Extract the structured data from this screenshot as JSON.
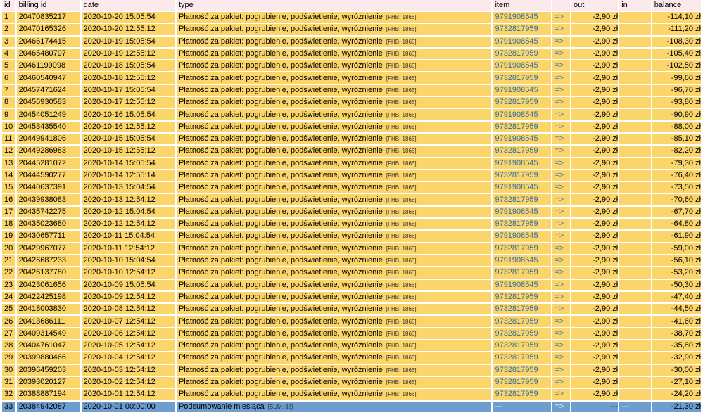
{
  "headers": {
    "id": "id",
    "billing_id": "billing id",
    "date": "date",
    "type": "type",
    "item": "item",
    "arrow": "",
    "out": "out",
    "in": "in",
    "balance": "balance"
  },
  "colors": {
    "row_bg": "#fbd56a",
    "summary_bg": "#6e9dcf",
    "header_bg": "#fce9ec",
    "link": "#2e6da8"
  },
  "rows": [
    {
      "id": "1",
      "billing_id": "20470835217",
      "date": "2020-10-20 15:05:54",
      "type": "Płatność za pakiet: pogrubienie, podświetlenie, wyróżnienie",
      "tag": "[FHB: 1866]",
      "item": "9791908545",
      "arrow": "=>",
      "out": "-2,90 zł",
      "in": "",
      "balance": "-114,10 zł"
    },
    {
      "id": "2",
      "billing_id": "20470165326",
      "date": "2020-10-20 12:55:12",
      "type": "Płatność za pakiet: pogrubienie, podświetlenie, wyróżnienie",
      "tag": "[FHB: 1866]",
      "item": "9732817959",
      "arrow": "=>",
      "out": "-2,90 zł",
      "in": "",
      "balance": "-111,20 zł"
    },
    {
      "id": "3",
      "billing_id": "20466174415",
      "date": "2020-10-19 15:05:54",
      "type": "Płatność za pakiet: pogrubienie, podświetlenie, wyróżnienie",
      "tag": "[FHB: 1866]",
      "item": "9791908545",
      "arrow": "=>",
      "out": "-2,90 zł",
      "in": "",
      "balance": "-108,30 zł"
    },
    {
      "id": "4",
      "billing_id": "20465480797",
      "date": "2020-10-19 12:55:12",
      "type": "Płatność za pakiet: pogrubienie, podświetlenie, wyróżnienie",
      "tag": "[FHB: 1866]",
      "item": "9732817959",
      "arrow": "=>",
      "out": "-2,90 zł",
      "in": "",
      "balance": "-105,40 zł"
    },
    {
      "id": "5",
      "billing_id": "20461199098",
      "date": "2020-10-18 15:05:54",
      "type": "Płatność za pakiet: pogrubienie, podświetlenie, wyróżnienie",
      "tag": "[FHB: 1866]",
      "item": "9791908545",
      "arrow": "=>",
      "out": "-2,90 zł",
      "in": "",
      "balance": "-102,50 zł"
    },
    {
      "id": "6",
      "billing_id": "20460540947",
      "date": "2020-10-18 12:55:12",
      "type": "Płatność za pakiet: pogrubienie, podświetlenie, wyróżnienie",
      "tag": "[FHB: 1866]",
      "item": "9732817959",
      "arrow": "=>",
      "out": "-2,90 zł",
      "in": "",
      "balance": "-99,60 zł"
    },
    {
      "id": "7",
      "billing_id": "20457471624",
      "date": "2020-10-17 15:05:54",
      "type": "Płatność za pakiet: pogrubienie, podświetlenie, wyróżnienie",
      "tag": "[FHB: 1866]",
      "item": "9791908545",
      "arrow": "=>",
      "out": "-2,90 zł",
      "in": "",
      "balance": "-96,70 zł"
    },
    {
      "id": "8",
      "billing_id": "20456930583",
      "date": "2020-10-17 12:55:12",
      "type": "Płatność za pakiet: pogrubienie, podświetlenie, wyróżnienie",
      "tag": "[FHB: 1866]",
      "item": "9732817959",
      "arrow": "=>",
      "out": "-2,90 zł",
      "in": "",
      "balance": "-93,80 zł"
    },
    {
      "id": "9",
      "billing_id": "20454051249",
      "date": "2020-10-16 15:05:54",
      "type": "Płatność za pakiet: pogrubienie, podświetlenie, wyróżnienie",
      "tag": "[FHB: 1866]",
      "item": "9791908545",
      "arrow": "=>",
      "out": "-2,90 zł",
      "in": "",
      "balance": "-90,90 zł"
    },
    {
      "id": "10",
      "billing_id": "20453435540",
      "date": "2020-10-16 12:55:12",
      "type": "Płatność za pakiet: pogrubienie, podświetlenie, wyróżnienie",
      "tag": "[FHB: 1866]",
      "item": "9732817959",
      "arrow": "=>",
      "out": "-2,90 zł",
      "in": "",
      "balance": "-88,00 zł"
    },
    {
      "id": "11",
      "billing_id": "20449941806",
      "date": "2020-10-15 15:05:54",
      "type": "Płatność za pakiet: pogrubienie, podświetlenie, wyróżnienie",
      "tag": "[FHB: 1866]",
      "item": "9791908545",
      "arrow": "=>",
      "out": "-2,90 zł",
      "in": "",
      "balance": "-85,10 zł"
    },
    {
      "id": "12",
      "billing_id": "20449286983",
      "date": "2020-10-15 12:55:12",
      "type": "Płatność za pakiet: pogrubienie, podświetlenie, wyróżnienie",
      "tag": "[FHB: 1866]",
      "item": "9732817959",
      "arrow": "=>",
      "out": "-2,90 zł",
      "in": "",
      "balance": "-82,20 zł"
    },
    {
      "id": "13",
      "billing_id": "20445281072",
      "date": "2020-10-14 15:05:54",
      "type": "Płatność za pakiet: pogrubienie, podświetlenie, wyróżnienie",
      "tag": "[FHB: 1866]",
      "item": "9791908545",
      "arrow": "=>",
      "out": "-2,90 zł",
      "in": "",
      "balance": "-79,30 zł"
    },
    {
      "id": "14",
      "billing_id": "20444590277",
      "date": "2020-10-14 12:55:14",
      "type": "Płatność za pakiet: pogrubienie, podświetlenie, wyróżnienie",
      "tag": "[FHB: 1866]",
      "item": "9732817959",
      "arrow": "=>",
      "out": "-2,90 zł",
      "in": "",
      "balance": "-76,40 zł"
    },
    {
      "id": "15",
      "billing_id": "20440637391",
      "date": "2020-10-13 15:04:54",
      "type": "Płatność za pakiet: pogrubienie, podświetlenie, wyróżnienie",
      "tag": "[FHB: 1866]",
      "item": "9791908545",
      "arrow": "=>",
      "out": "-2,90 zł",
      "in": "",
      "balance": "-73,50 zł"
    },
    {
      "id": "16",
      "billing_id": "20439938083",
      "date": "2020-10-13 12:54:12",
      "type": "Płatność za pakiet: pogrubienie, podświetlenie, wyróżnienie",
      "tag": "[FHB: 1866]",
      "item": "9732817959",
      "arrow": "=>",
      "out": "-2,90 zł",
      "in": "",
      "balance": "-70,60 zł"
    },
    {
      "id": "17",
      "billing_id": "20435742275",
      "date": "2020-10-12 15:04:54",
      "type": "Płatność za pakiet: pogrubienie, podświetlenie, wyróżnienie",
      "tag": "[FHB: 1866]",
      "item": "9791908545",
      "arrow": "=>",
      "out": "-2,90 zł",
      "in": "",
      "balance": "-67,70 zł"
    },
    {
      "id": "18",
      "billing_id": "20435023680",
      "date": "2020-10-12 12:54:12",
      "type": "Płatność za pakiet: pogrubienie, podświetlenie, wyróżnienie",
      "tag": "[FHB: 1866]",
      "item": "9732817959",
      "arrow": "=>",
      "out": "-2,90 zł",
      "in": "",
      "balance": "-64,80 zł"
    },
    {
      "id": "19",
      "billing_id": "20430657711",
      "date": "2020-10-11 15:04:54",
      "type": "Płatność za pakiet: pogrubienie, podświetlenie, wyróżnienie",
      "tag": "[FHB: 1866]",
      "item": "9791908545",
      "arrow": "=>",
      "out": "-2,90 zł",
      "in": "",
      "balance": "-61,90 zł"
    },
    {
      "id": "20",
      "billing_id": "20429967077",
      "date": "2020-10-11 12:54:12",
      "type": "Płatność za pakiet: pogrubienie, podświetlenie, wyróżnienie",
      "tag": "[FHB: 1866]",
      "item": "9732817959",
      "arrow": "=>",
      "out": "-2,90 zł",
      "in": "",
      "balance": "-59,00 zł"
    },
    {
      "id": "21",
      "billing_id": "20426687233",
      "date": "2020-10-10 15:04:54",
      "type": "Płatność za pakiet: pogrubienie, podświetlenie, wyróżnienie",
      "tag": "[FHB: 1866]",
      "item": "9791908545",
      "arrow": "=>",
      "out": "-2,90 zł",
      "in": "",
      "balance": "-56,10 zł"
    },
    {
      "id": "22",
      "billing_id": "20426137780",
      "date": "2020-10-10 12:54:12",
      "type": "Płatność za pakiet: pogrubienie, podświetlenie, wyróżnienie",
      "tag": "[FHB: 1866]",
      "item": "9732817959",
      "arrow": "=>",
      "out": "-2,90 zł",
      "in": "",
      "balance": "-53,20 zł"
    },
    {
      "id": "23",
      "billing_id": "20423061656",
      "date": "2020-10-09 15:05:54",
      "type": "Płatność za pakiet: pogrubienie, podświetlenie, wyróżnienie",
      "tag": "[FHB: 1866]",
      "item": "9791908545",
      "arrow": "=>",
      "out": "-2,90 zł",
      "in": "",
      "balance": "-50,30 zł"
    },
    {
      "id": "24",
      "billing_id": "20422425198",
      "date": "2020-10-09 12:54:12",
      "type": "Płatność za pakiet: pogrubienie, podświetlenie, wyróżnienie",
      "tag": "[FHB: 1866]",
      "item": "9732817959",
      "arrow": "=>",
      "out": "-2,90 zł",
      "in": "",
      "balance": "-47,40 zł"
    },
    {
      "id": "25",
      "billing_id": "20418003830",
      "date": "2020-10-08 12:54:12",
      "type": "Płatność za pakiet: pogrubienie, podświetlenie, wyróżnienie",
      "tag": "[FHB: 1866]",
      "item": "9732817959",
      "arrow": "=>",
      "out": "-2,90 zł",
      "in": "",
      "balance": "-44,50 zł"
    },
    {
      "id": "26",
      "billing_id": "20413686111",
      "date": "2020-10-07 12:54:12",
      "type": "Płatność za pakiet: pogrubienie, podświetlenie, wyróżnienie",
      "tag": "[FHB: 1866]",
      "item": "9732817959",
      "arrow": "=>",
      "out": "-2,90 zł",
      "in": "",
      "balance": "-41,60 zł"
    },
    {
      "id": "27",
      "billing_id": "20409314549",
      "date": "2020-10-06 12:54:12",
      "type": "Płatność za pakiet: pogrubienie, podświetlenie, wyróżnienie",
      "tag": "[FHB: 1866]",
      "item": "9732817959",
      "arrow": "=>",
      "out": "-2,90 zł",
      "in": "",
      "balance": "-38,70 zł"
    },
    {
      "id": "28",
      "billing_id": "20404761047",
      "date": "2020-10-05 12:54:12",
      "type": "Płatność za pakiet: pogrubienie, podświetlenie, wyróżnienie",
      "tag": "[FHB: 1866]",
      "item": "9732817959",
      "arrow": "=>",
      "out": "-2,90 zł",
      "in": "",
      "balance": "-35,80 zł"
    },
    {
      "id": "29",
      "billing_id": "20399880466",
      "date": "2020-10-04 12:54:12",
      "type": "Płatność za pakiet: pogrubienie, podświetlenie, wyróżnienie",
      "tag": "[FHB: 1866]",
      "item": "9732817959",
      "arrow": "=>",
      "out": "-2,90 zł",
      "in": "",
      "balance": "-32,90 zł"
    },
    {
      "id": "30",
      "billing_id": "20396459203",
      "date": "2020-10-03 12:54:12",
      "type": "Płatność za pakiet: pogrubienie, podświetlenie, wyróżnienie",
      "tag": "[FHB: 1866]",
      "item": "9732817959",
      "arrow": "=>",
      "out": "-2,90 zł",
      "in": "",
      "balance": "-30,00 zł"
    },
    {
      "id": "31",
      "billing_id": "20393020127",
      "date": "2020-10-02 12:54:12",
      "type": "Płatność za pakiet: pogrubienie, podświetlenie, wyróżnienie",
      "tag": "[FHB: 1866]",
      "item": "9732817959",
      "arrow": "=>",
      "out": "-2,90 zł",
      "in": "",
      "balance": "-27,10 zł"
    },
    {
      "id": "32",
      "billing_id": "20388887194",
      "date": "2020-10-01 12:54:12",
      "type": "Płatność za pakiet: pogrubienie, podświetlenie, wyróżnienie",
      "tag": "[FHB: 1866]",
      "item": "9732817959",
      "arrow": "=>",
      "out": "-2,90 zł",
      "in": "",
      "balance": "-24,20 zł"
    }
  ],
  "summary": {
    "id": "33",
    "billing_id": "20384942087",
    "date": "2020-10-01 00:00:00",
    "type": "Podsumowanie miesiąca",
    "tag": "[SUM: 38]",
    "item": "---",
    "arrow": "=>",
    "out": "---",
    "in": "---",
    "balance": "-21,30 zł"
  }
}
